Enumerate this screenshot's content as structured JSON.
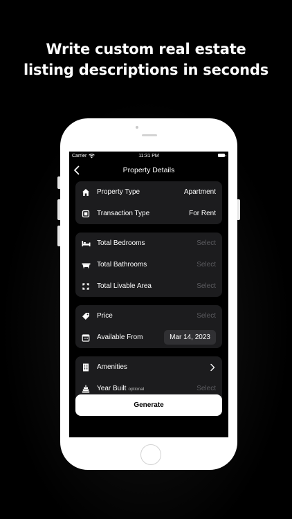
{
  "headline": {
    "line1": "Write custom real estate",
    "line2": "listing descriptions in seconds"
  },
  "status_bar": {
    "carrier": "Carrier",
    "time": "11:31 PM"
  },
  "nav": {
    "title": "Property Details"
  },
  "sections": {
    "property": {
      "property_type": {
        "label": "Property Type",
        "value": "Apartment",
        "icon": "house-icon"
      },
      "transaction_type": {
        "label": "Transaction Type",
        "value": "For Rent",
        "icon": "transaction-icon"
      }
    },
    "rooms": {
      "total_bedrooms": {
        "label": "Total Bedrooms",
        "value": "Select",
        "icon": "bed-icon"
      },
      "total_bathrooms": {
        "label": "Total Bathrooms",
        "value": "Select",
        "icon": "bathtub-icon"
      },
      "total_livable_area": {
        "label": "Total Livable Area",
        "value": "Select",
        "icon": "area-icon"
      }
    },
    "pricing": {
      "price": {
        "label": "Price",
        "value": "Select",
        "icon": "price-tag-icon"
      },
      "available_from": {
        "label": "Available From",
        "value": "Mar 14, 2023",
        "icon": "calendar-icon"
      }
    },
    "extras": {
      "amenities": {
        "label": "Amenities",
        "icon": "building-icon"
      },
      "year_built": {
        "label": "Year Built",
        "optional_note": "optional",
        "value": "Select",
        "icon": "cake-icon"
      }
    }
  },
  "actions": {
    "generate_label": "Generate"
  },
  "colors": {
    "background": "#000000",
    "card": "#1c1c1e",
    "muted_text": "#5b5b5f",
    "chip": "#303033",
    "button": "#ffffff"
  }
}
